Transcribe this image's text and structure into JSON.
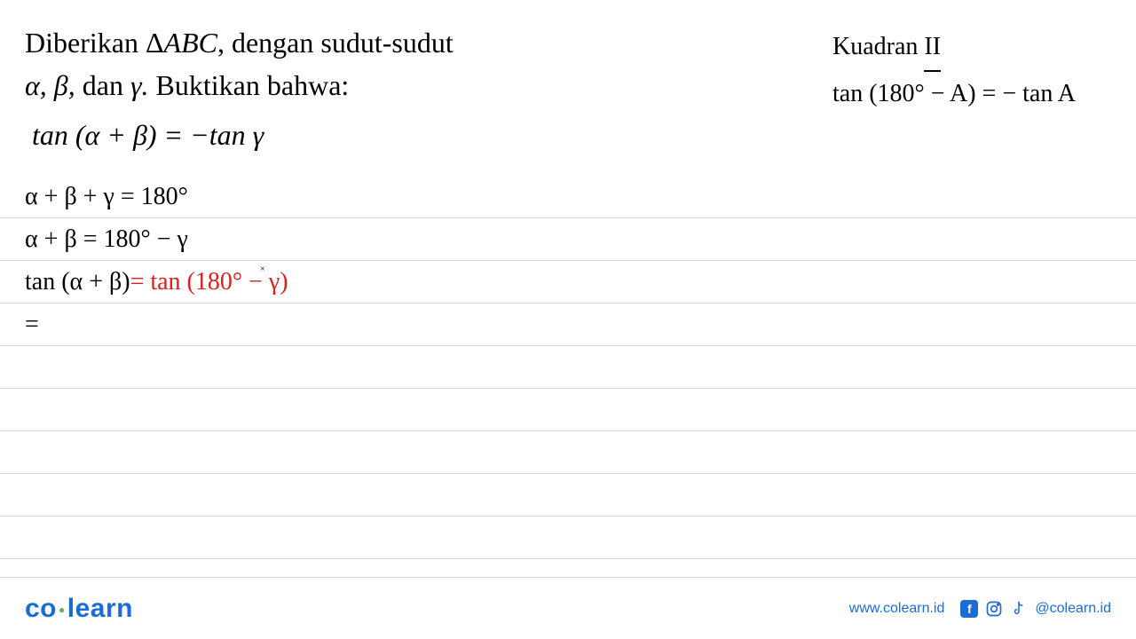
{
  "problem": {
    "line1_pre": "Diberikan  Δ",
    "line1_abc": "ABC",
    "line1_post": ",  dengan  sudut-sudut",
    "line2_pre": "α,  β, ",
    "line2_dan": "dan",
    "line2_gamma": "  γ.",
    "line2_post": "  Buktikan  bahwa:",
    "line3": "tan (α + β) = −tan γ"
  },
  "sidenote": {
    "kuadran_label": "Kuadran ",
    "kuadran_num": "II",
    "identity": "tan (180° − A) = − tan A"
  },
  "work": {
    "line1": "α + β + γ = 180°",
    "line2": "α + β = 180° − γ",
    "line3_black": "tan (α + β) ",
    "line3_red": "= tan (180° − γ)",
    "line4": "="
  },
  "cursor": "×",
  "footer": {
    "logo_co": "co",
    "logo_learn": "learn",
    "url": "www.colearn.id",
    "handle": "@colearn.id",
    "fb_letter": "f"
  }
}
